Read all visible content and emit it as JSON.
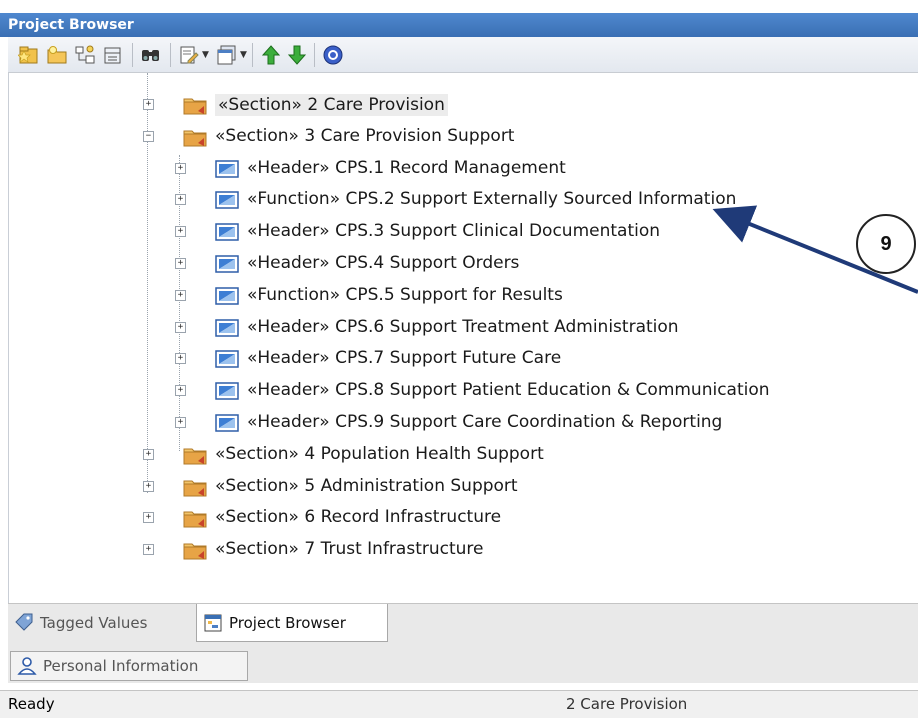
{
  "window": {
    "title": "Project Browser"
  },
  "toolbar": {
    "buttons": [
      {
        "icon": "new-package-icon"
      },
      {
        "icon": "new-folder-icon"
      },
      {
        "icon": "new-diagram-icon"
      },
      {
        "icon": "new-element-icon"
      },
      {
        "icon": "find-icon"
      },
      {
        "icon": "edit-menu-icon"
      },
      {
        "icon": "view-menu-icon"
      },
      {
        "icon": "move-up-icon"
      },
      {
        "icon": "move-down-icon"
      },
      {
        "icon": "help-icon"
      }
    ]
  },
  "tree": {
    "nodes": [
      {
        "label": "«Section» 2 Care Provision",
        "kind": "folder",
        "expander": "+"
      },
      {
        "label": "«Section» 3 Care Provision Support",
        "kind": "folder",
        "expander": "−"
      },
      {
        "label": "«Header» CPS.1 Record Management",
        "kind": "element",
        "expander": "+"
      },
      {
        "label": "«Function» CPS.2 Support Externally Sourced Information",
        "kind": "element",
        "expander": "+"
      },
      {
        "label": "«Header» CPS.3 Support Clinical Documentation",
        "kind": "element",
        "expander": "+"
      },
      {
        "label": "«Header» CPS.4 Support Orders",
        "kind": "element",
        "expander": "+"
      },
      {
        "label": "«Function» CPS.5 Support for Results",
        "kind": "element",
        "expander": "+"
      },
      {
        "label": "«Header» CPS.6 Support Treatment Administration",
        "kind": "element",
        "expander": "+"
      },
      {
        "label": "«Header» CPS.7 Support Future Care",
        "kind": "element",
        "expander": "+"
      },
      {
        "label": "«Header» CPS.8 Support Patient Education & Communication",
        "kind": "element",
        "expander": "+"
      },
      {
        "label": "«Header» CPS.9 Support Care Coordination & Reporting",
        "kind": "element",
        "expander": "+"
      },
      {
        "label": "«Section» 4 Population Health Support",
        "kind": "folder",
        "expander": "+"
      },
      {
        "label": "«Section» 5 Administration Support",
        "kind": "folder",
        "expander": "+"
      },
      {
        "label": "«Section» 6 Record Infrastructure",
        "kind": "folder",
        "expander": "+"
      },
      {
        "label": "«Section» 7 Trust Infrastructure",
        "kind": "folder",
        "expander": "+"
      }
    ]
  },
  "tabs": {
    "tagged_values": "Tagged Values",
    "project_browser": "Project Browser",
    "personal_information": "Personal Information"
  },
  "status": {
    "left": "Ready",
    "right": "2 Care Provision"
  },
  "callout": {
    "number": "9"
  },
  "colors": {
    "title_bar": "#3f78bf",
    "callout_arrow": "#1f3a78",
    "folder": "#e0a64a",
    "element": "#3d7ed4"
  }
}
